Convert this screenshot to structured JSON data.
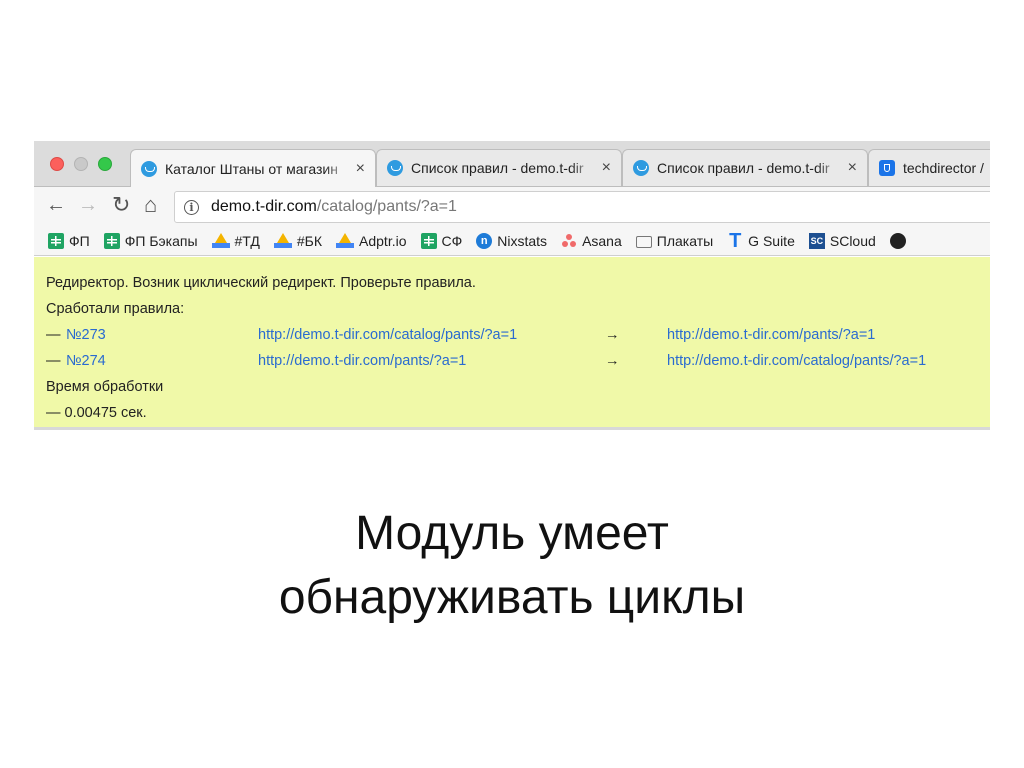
{
  "tabs": [
    {
      "title": "Каталог Штаны от магазин",
      "close": "×",
      "favicon": "basket-icon",
      "active": true
    },
    {
      "title": "Список правил - demo.t-dir",
      "close": "×",
      "favicon": "basket-icon",
      "active": false
    },
    {
      "title": "Список правил - demo.t-dir",
      "close": "×",
      "favicon": "basket-icon",
      "active": false
    },
    {
      "title": "techdirector /",
      "close": "",
      "favicon": "shield-icon",
      "active": false
    }
  ],
  "toolbar": {
    "back": "←",
    "forward": "→",
    "reload": "↻",
    "home": "⌂",
    "url_host": "demo.t-dir.com",
    "url_path": "/catalog/pants/?a=1",
    "info": "i"
  },
  "bookmarks": [
    {
      "label": "ФП",
      "icon": "sheets-icon"
    },
    {
      "label": "ФП Бэкапы",
      "icon": "sheets-icon"
    },
    {
      "label": "#ТД",
      "icon": "drive-icon"
    },
    {
      "label": "#БК",
      "icon": "drive-icon"
    },
    {
      "label": "Adptr.io",
      "icon": "drive-icon"
    },
    {
      "label": "СФ",
      "icon": "sheets-icon"
    },
    {
      "label": "Nixstats",
      "icon": "nixstats-icon"
    },
    {
      "label": "Asana",
      "icon": "asana-icon"
    },
    {
      "label": "Плакаты",
      "icon": "folder-icon"
    },
    {
      "label": "G Suite",
      "icon": "gsuite-icon"
    },
    {
      "label": "SCloud",
      "icon": "scloud-icon"
    },
    {
      "label": "",
      "icon": "github-icon"
    }
  ],
  "content": {
    "line1": "Редиректор. Возник циклический редирект. Проверьте правила.",
    "line2": "Сработали правила:",
    "rules": [
      {
        "dash": "—",
        "id": "№273",
        "from": "http://demo.t-dir.com/catalog/pants/?a=1",
        "arrow": "→",
        "to": "http://demo.t-dir.com/pants/?a=1"
      },
      {
        "dash": "—",
        "id": "№274",
        "from": "http://demo.t-dir.com/pants/?a=1",
        "arrow": "→",
        "to": "http://demo.t-dir.com/catalog/pants/?a=1"
      }
    ],
    "time_label": "Время обработки",
    "time_value": "— 0.00475 сек."
  },
  "caption": {
    "line1": "Модуль умеет",
    "line2": "обнаруживать циклы"
  },
  "colors": {
    "content_bg": "#f0f9a8",
    "link": "#2a6bd0"
  }
}
